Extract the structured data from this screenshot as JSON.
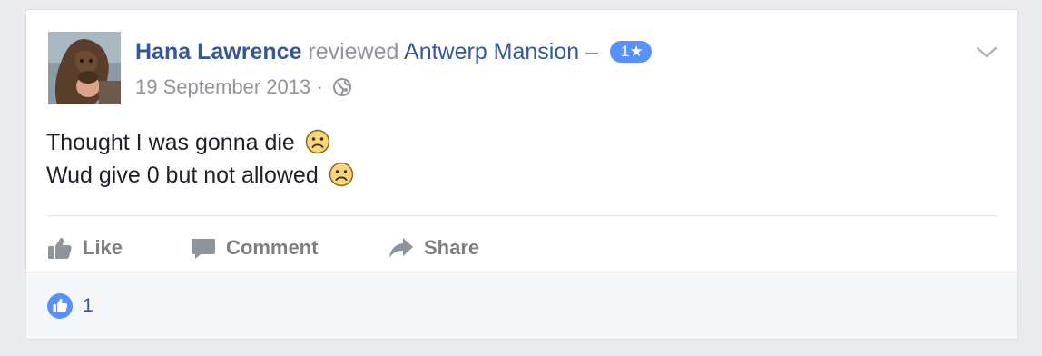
{
  "post": {
    "author": "Hana Lawrence",
    "action_text": "reviewed",
    "place": "Antwerp Mansion",
    "separator": "–",
    "rating_badge": "1★",
    "date": "19 September 2013",
    "meta_separator": "·",
    "privacy_icon": "globe-icon",
    "menu_icon": "chevron-down-icon",
    "body_lines": [
      "Thought I was gonna die",
      "Wud give 0 but not allowed"
    ],
    "body_emoji": "frowning-face-emoji"
  },
  "actions": {
    "like_label": "Like",
    "comment_label": "Comment",
    "share_label": "Share"
  },
  "reactions": {
    "like_count": "1"
  },
  "colors": {
    "link_blue": "#365899",
    "badge_blue": "#5890ff",
    "muted_gray": "#90949c",
    "background": "#e9ebee"
  }
}
